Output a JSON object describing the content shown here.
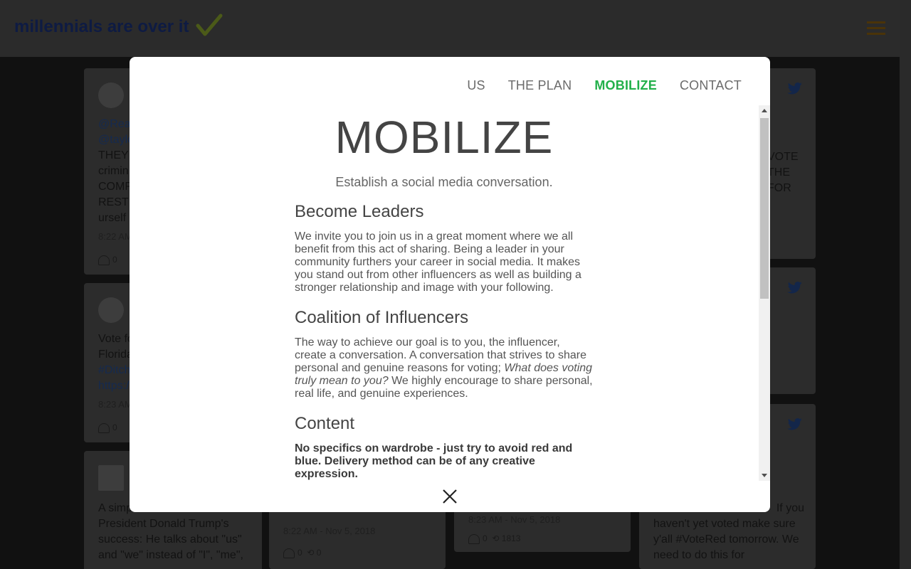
{
  "header": {
    "brand": "millennials are over it"
  },
  "background_cards": [
    {
      "text_lines": [
        "@Rea",
        "@taylo",
        "THEY",
        "crimin",
        "COMP",
        "RESTI",
        "urself"
      ],
      "time": "8:22 AM",
      "likes": "0"
    },
    {
      "text_lines": [
        "Vote fo",
        "Florida",
        "#Ditch",
        "https:/"
      ],
      "time": "8:23 AM",
      "likes": "0"
    },
    {
      "text_lines": [
        "A simp",
        "President Donald Trump's",
        "success: He talks about \"us\"",
        "and \"we\" instead of \"I\", \"me\","
      ],
      "time": "",
      "likes": ""
    },
    {
      "text_lines": [],
      "time": "8:22 AM - Nov 5, 2018",
      "likes": "0",
      "retweets": "0"
    },
    {
      "text_lines": [],
      "time": "8:23 AM - Nov 5, 2018",
      "likes": "0",
      "retweets": "1813"
    },
    {
      "text_lines": [
        "VOTE",
        "THE",
        "FOR"
      ],
      "time": "",
      "likes": ""
    },
    {
      "text_lines": [
        "If you",
        "haven't yet voted make sure",
        "y'all #VoteRed tomorrow. We",
        "need to do this for"
      ],
      "time": "",
      "likes": ""
    }
  ],
  "modal": {
    "nav": [
      {
        "label": "US",
        "active": false
      },
      {
        "label": "THE PLAN",
        "active": false
      },
      {
        "label": "MOBILIZE",
        "active": true
      },
      {
        "label": "CONTACT",
        "active": false
      }
    ],
    "title": "MOBILIZE",
    "subtitle": "Establish a social media conversation.",
    "sections": [
      {
        "heading": "Become Leaders",
        "body": "We invite you to join us in a great moment where we all benefit from this act of sharing. Being a leader in your community furthers your career in social media. It makes you stand out from other influencers as well as building a stronger relationship and image with your following."
      },
      {
        "heading": "Coalition of Influencers",
        "body_pre": "The way to achieve our goal is to you, the influencer, create a conversation. A conversation that strives to share personal and genuine reasons for voting; ",
        "body_em": "What does voting truly mean to you?",
        "body_post": " We highly encourage to share personal, real life, and genuine experiences."
      },
      {
        "heading": "Content",
        "body": "No specifics on wardrobe - just try to avoid red and blue. Delivery method can be of any creative expression."
      }
    ]
  },
  "colors": {
    "active_nav": "#22b04a",
    "nav": "#6b6b6b",
    "overlay": "#111111"
  }
}
